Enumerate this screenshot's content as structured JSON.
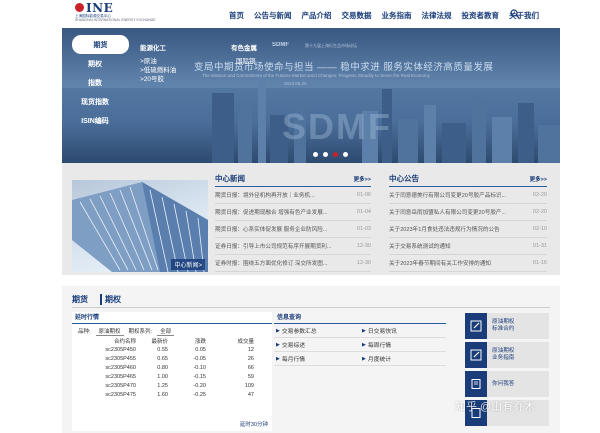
{
  "header": {
    "logo_text": "INE",
    "logo_sub_cn": "上海国际能源交易中心",
    "logo_sub_en": "SHANGHAI INTERNATIONAL ENERGY EXCHANGE",
    "nav": [
      "首页",
      "公告与新闻",
      "产品介绍",
      "交易数据",
      "业务指南",
      "法律法规",
      "投资者教育",
      "关于我们"
    ]
  },
  "banner": {
    "title": "变局中期货市场使命与担当 —— 稳中求进 服务实体经济高质量发展",
    "subtitle": "The Mission and Commitment of the Futures Market amid Changes: Progress Steadily to Serve the Real Economy",
    "date": "2023.05.20",
    "brand_small": "SDMF",
    "brand_small_sub": "第十九届上海衍生品市场论坛",
    "brand_big": "SDMF",
    "slide_count": 4,
    "active_slide": 3
  },
  "side_menu": [
    "期货",
    "期权",
    "指数",
    "现货指数",
    "ISIN编码"
  ],
  "submenu": {
    "energy": {
      "head": "能源化工",
      "items": [
        ">原油",
        ">低硫燃料油",
        ">20号胶"
      ]
    },
    "metals": {
      "head": "有色金属",
      "items": [
        "国际铜"
      ]
    }
  },
  "news": {
    "image_caption": "中心新闻>",
    "center_news": {
      "title": "中心新闻",
      "more": "更多>>",
      "items": [
        {
          "text": "期货日报：境外径机构再开放｜业务机...",
          "date": "01-06"
        },
        {
          "text": "期货日报：促进期现融合 增强有色产业发展...",
          "date": "01-04"
        },
        {
          "text": "期货日报：心系实体促发展 服务企业防风险...",
          "date": "01-03"
        },
        {
          "text": "证券日报：引导上市公司规范有序开展期货利...",
          "date": "12-30"
        },
        {
          "text": "证券时报：围绕五方面优化修订 深交所发图...",
          "date": "12-30"
        }
      ]
    },
    "center_notices": {
      "title": "中心公告",
      "more": "更多>>",
      "items": [
        {
          "text": "关于同意德美行有限公司变更20号胶产品标识...",
          "date": "02-20"
        },
        {
          "text": "关于同意岳雨加盟私人有限公司变更20号胶产...",
          "date": "02-20"
        },
        {
          "text": "关于2023年1月食处违法违规行为情况的公告",
          "date": "02-10"
        },
        {
          "text": "关于交易系统测试的通知",
          "date": "01-31"
        },
        {
          "text": "关于2023年春节期间有关工作安排的通知",
          "date": "01-16"
        }
      ]
    }
  },
  "market": {
    "tabs": [
      "期货",
      "期权"
    ],
    "active_tab": "期权",
    "quotes_title": "延时行情",
    "filter": {
      "label_variety": "品种:",
      "variety_value": "原油期权",
      "label_sub": "期权系列:",
      "sub_value": "全部"
    },
    "columns": [
      "合约名称",
      "最新价",
      "涨跌",
      "成交量"
    ],
    "rows": [
      {
        "name": "sc2305P450",
        "price": "0.55",
        "change": "0.05",
        "dir": "up",
        "vol": "12"
      },
      {
        "name": "sc2305P455",
        "price": "0.65",
        "change": "-0.05",
        "dir": "down",
        "vol": "26"
      },
      {
        "name": "sc2305P460",
        "price": "0.80",
        "change": "-0.10",
        "dir": "down",
        "vol": "66"
      },
      {
        "name": "sc2305P465",
        "price": "1.00",
        "change": "-0.15",
        "dir": "down",
        "vol": "59"
      },
      {
        "name": "sc2305P470",
        "price": "1.25",
        "change": "-0.20",
        "dir": "down",
        "vol": "109"
      },
      {
        "name": "sc2305P475",
        "price": "1.60",
        "change": "-0.25",
        "dir": "down",
        "vol": "47"
      }
    ],
    "delay_note": "延时30分钟",
    "info_title": "信息查询",
    "info_links": [
      "交易参数汇总",
      "日交易快讯",
      "交易综述",
      "每周行情",
      "每月行情",
      "月度统计"
    ],
    "services": [
      {
        "label": "原油期权\n标准合约",
        "icon": "edit-icon"
      },
      {
        "label": "原油期权\n业务指南",
        "icon": "edit-icon"
      },
      {
        "label": "你问我答",
        "icon": "book-icon"
      },
      {
        "label": "",
        "icon": "document-icon"
      }
    ]
  },
  "watermark": "知乎 @山有乔木",
  "colors": {
    "primary": "#1a3d7a",
    "accent": "#c9202a",
    "up": "#c9202a",
    "down": "#1a9e3a"
  }
}
